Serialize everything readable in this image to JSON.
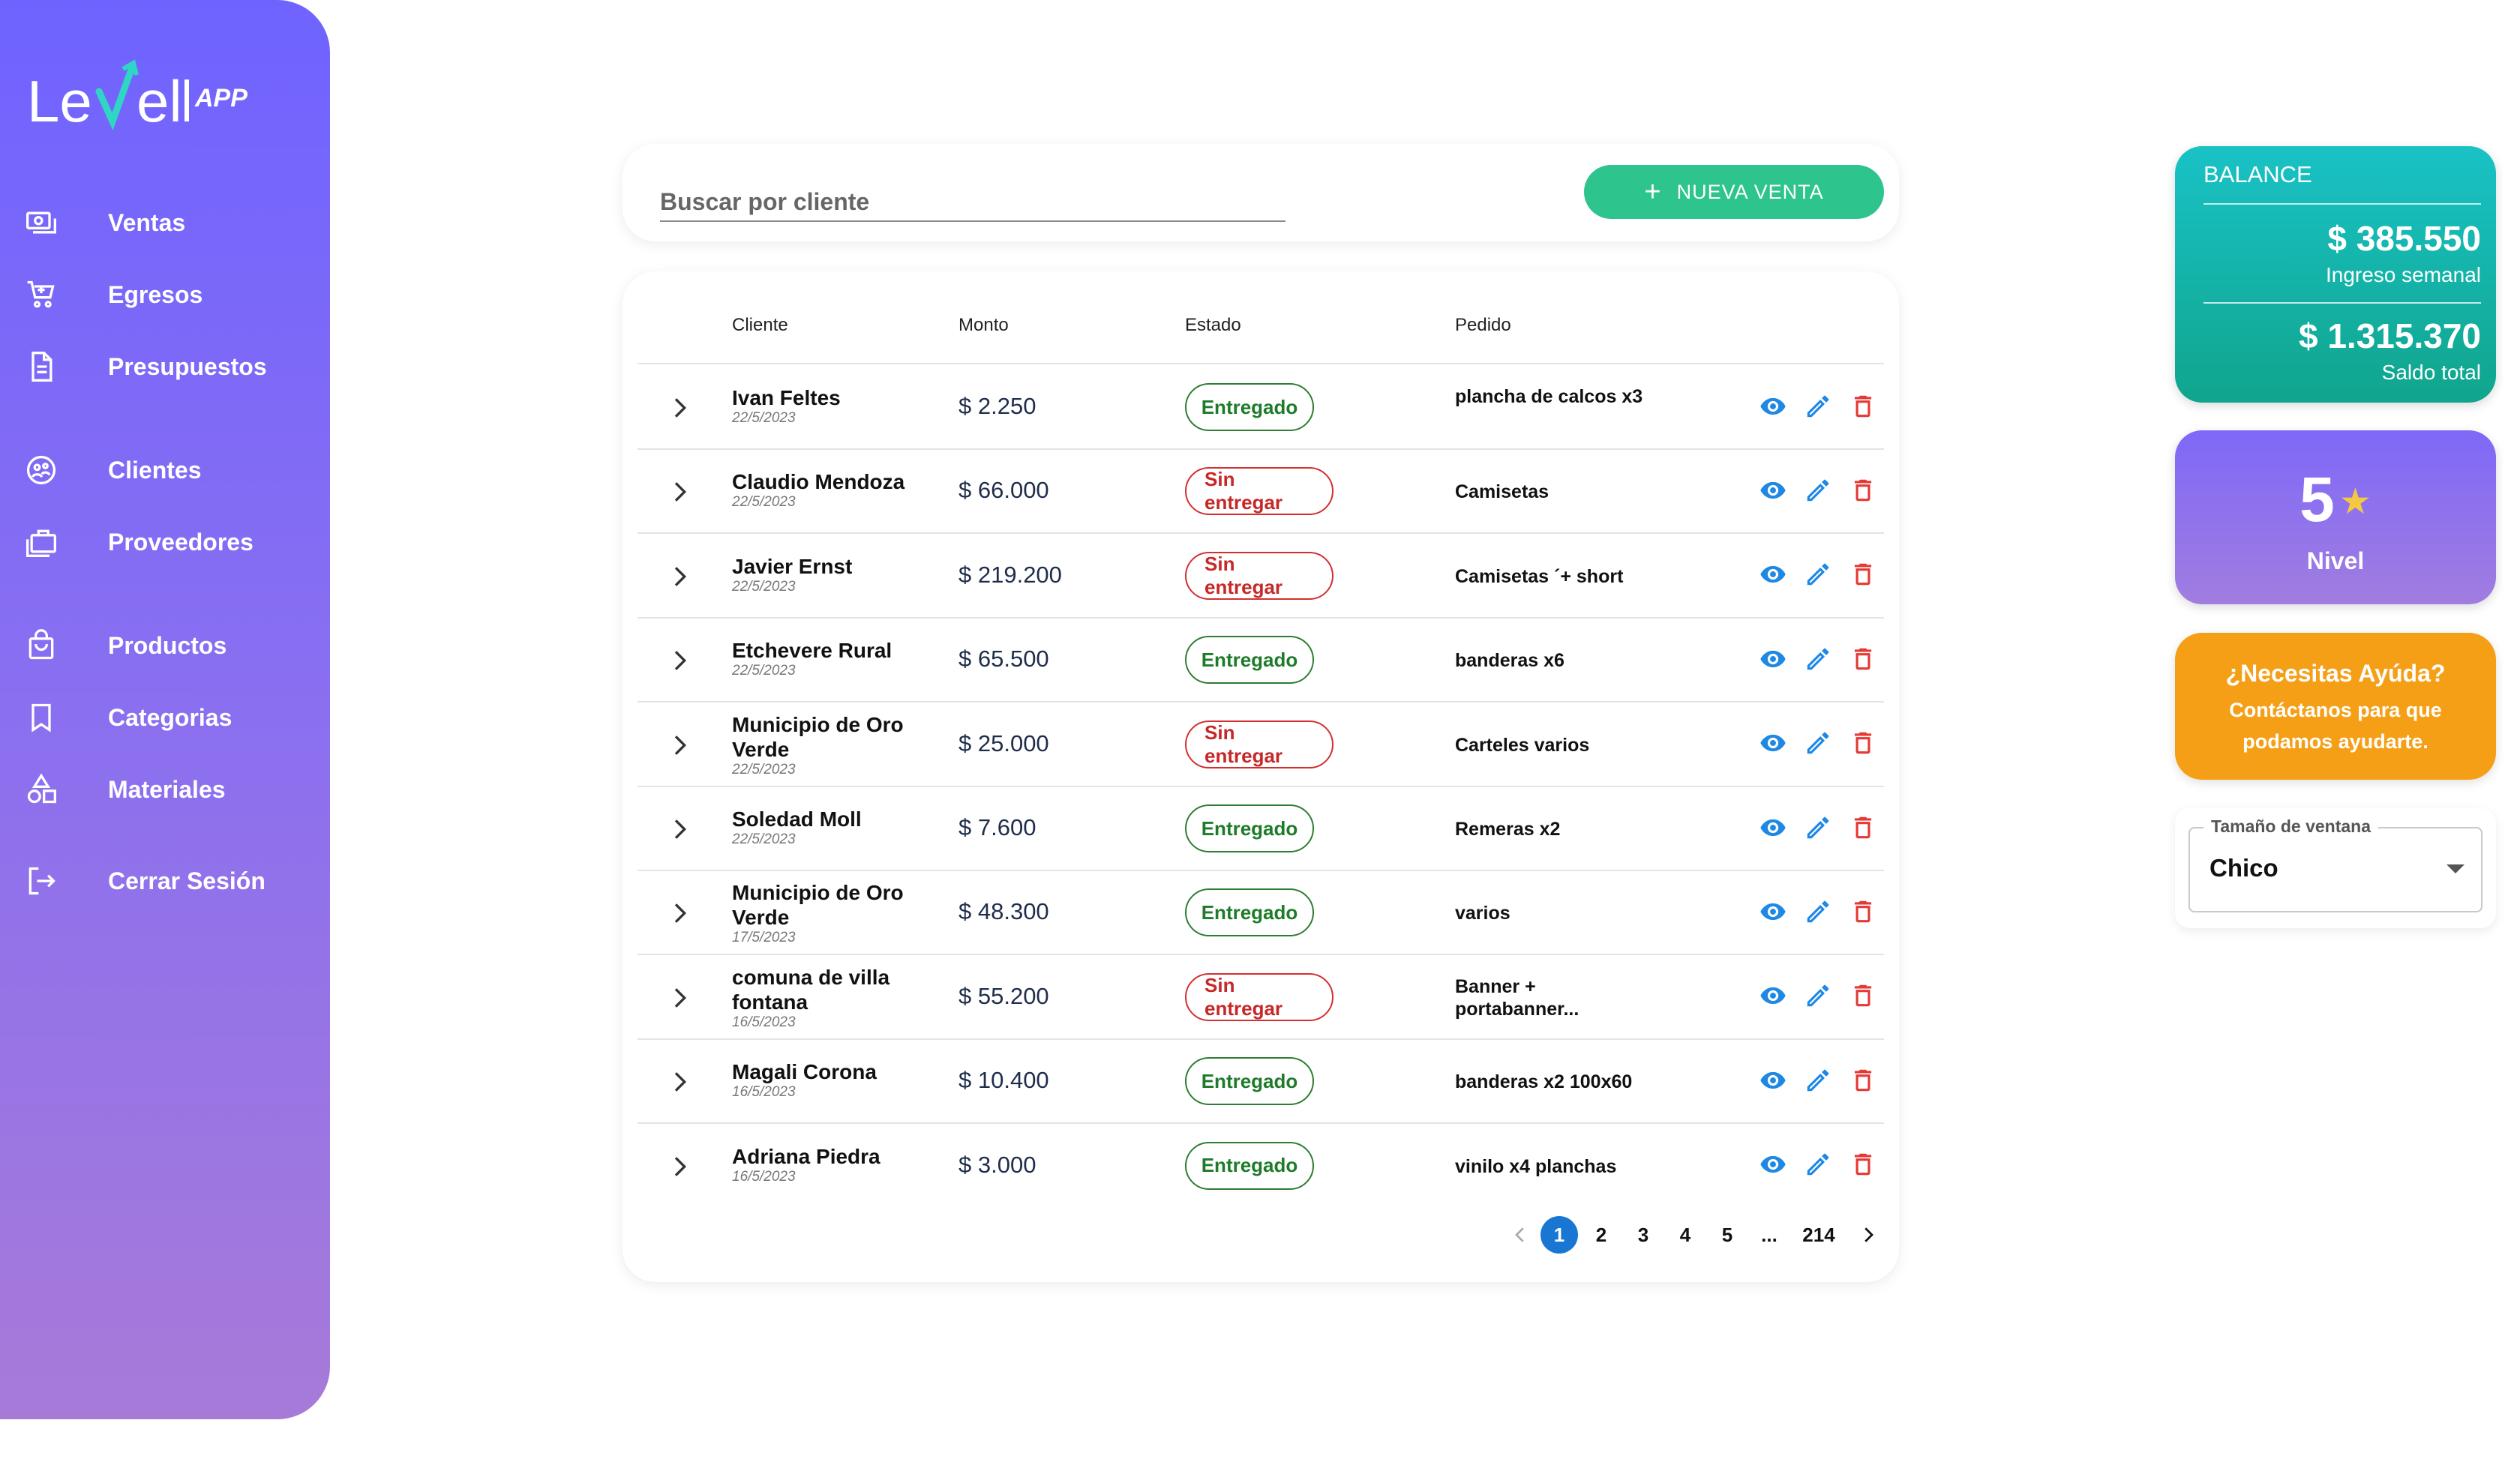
{
  "app": {
    "logo_text": "Level",
    "logo_suffix": "APP"
  },
  "sidebar": {
    "items": [
      {
        "label": "Ventas",
        "icon": "money-icon"
      },
      {
        "label": "Egresos",
        "icon": "cart-icon"
      },
      {
        "label": "Presupuestos",
        "icon": "document-icon"
      },
      {
        "label": "Clientes",
        "icon": "clients-icon"
      },
      {
        "label": "Proveedores",
        "icon": "briefcase-icon"
      },
      {
        "label": "Productos",
        "icon": "bag-icon"
      },
      {
        "label": "Categorias",
        "icon": "bookmark-icon"
      },
      {
        "label": "Materiales",
        "icon": "shapes-icon"
      },
      {
        "label": "Cerrar Sesión",
        "icon": "logout-icon"
      }
    ]
  },
  "search": {
    "placeholder": "Buscar por cliente",
    "value": ""
  },
  "new_sale_button": {
    "label": "NUEVA VENTA"
  },
  "table": {
    "columns": {
      "cliente": "Cliente",
      "monto": "Monto",
      "estado": "Estado",
      "pedido": "Pedido"
    },
    "rows": [
      {
        "name": "Ivan Feltes",
        "date": "22/5/2023",
        "amount": "$ 2.250",
        "status": "Entregado",
        "status_type": "ok",
        "order": "plancha de calcos x3"
      },
      {
        "name": "Claudio Mendoza",
        "date": "22/5/2023",
        "amount": "$ 66.000",
        "status": "Sin entregar",
        "status_type": "no",
        "order": "Camisetas"
      },
      {
        "name": "Javier Ernst",
        "date": "22/5/2023",
        "amount": "$ 219.200",
        "status": "Sin entregar",
        "status_type": "no",
        "order": "Camisetas ´+ short"
      },
      {
        "name": "Etchevere Rural",
        "date": "22/5/2023",
        "amount": "$ 65.500",
        "status": "Entregado",
        "status_type": "ok",
        "order": "banderas x6"
      },
      {
        "name": "Municipio de Oro Verde",
        "date": "22/5/2023",
        "amount": "$ 25.000",
        "status": "Sin entregar",
        "status_type": "no",
        "order": "Carteles varios"
      },
      {
        "name": "Soledad Moll",
        "date": "22/5/2023",
        "amount": "$ 7.600",
        "status": "Entregado",
        "status_type": "ok",
        "order": "Remeras x2"
      },
      {
        "name": "Municipio de Oro Verde",
        "date": "17/5/2023",
        "amount": "$ 48.300",
        "status": "Entregado",
        "status_type": "ok",
        "order": "varios"
      },
      {
        "name": "comuna de villa fontana",
        "date": "16/5/2023",
        "amount": "$ 55.200",
        "status": "Sin entregar",
        "status_type": "no",
        "order": "Banner + portabanner..."
      },
      {
        "name": "Magali Corona",
        "date": "16/5/2023",
        "amount": "$ 10.400",
        "status": "Entregado",
        "status_type": "ok",
        "order": "banderas x2 100x60"
      },
      {
        "name": "Adriana Piedra",
        "date": "16/5/2023",
        "amount": "$ 3.000",
        "status": "Entregado",
        "status_type": "ok",
        "order": "vinilo x4 planchas"
      }
    ]
  },
  "pagination": {
    "current": "1",
    "pages": [
      "1",
      "2",
      "3",
      "4",
      "5",
      "...",
      "214"
    ]
  },
  "balance": {
    "title": "BALANCE",
    "weekly_value": "$ 385.550",
    "weekly_label": "Ingreso semanal",
    "total_value": "$ 1.315.370",
    "total_label": "Saldo total"
  },
  "level": {
    "value": "5",
    "label": "Nivel"
  },
  "help": {
    "title": "¿Necesitas Ayúda?",
    "text": "Contáctanos para que podamos ayudarte."
  },
  "window_size": {
    "legend": "Tamaño de ventana",
    "value": "Chico"
  },
  "colors": {
    "accent_green": "#2ec48d",
    "delivered": "#2e7d32",
    "not_delivered": "#d32f2f",
    "primary_blue": "#1976d2",
    "balance_teal": "#10a58c",
    "help_orange": "#f59f17"
  }
}
